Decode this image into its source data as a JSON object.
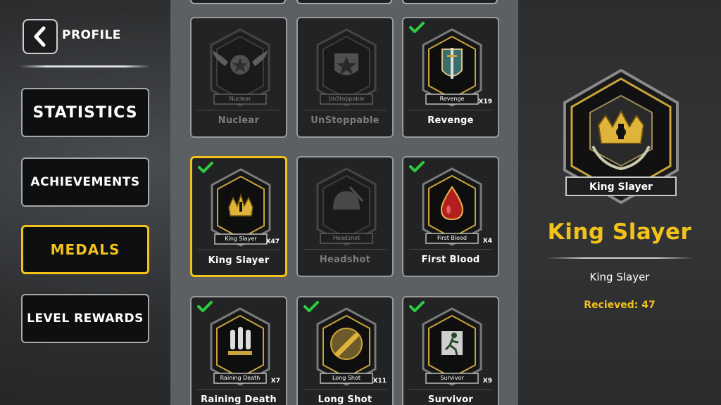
{
  "header": {
    "back_icon": "chevron-left-icon",
    "title": "PROFILE"
  },
  "nav": [
    {
      "label": "STATISTICS",
      "active": false
    },
    {
      "label": "ACHIEVEMENTS",
      "active": false
    },
    {
      "label": "MEDALS",
      "active": true
    },
    {
      "label": "LEVEL REWARDS",
      "active": false
    }
  ],
  "medals": [
    {
      "name": "Nuclear",
      "ribbon": "Nuclear",
      "count": "",
      "unlocked": false,
      "icon": "wings-star-icon"
    },
    {
      "name": "UnStoppable",
      "ribbon": "UnStoppable",
      "count": "",
      "unlocked": false,
      "icon": "shield-star-icon"
    },
    {
      "name": "Revenge",
      "ribbon": "Revenge",
      "count": "X19",
      "unlocked": true,
      "icon": "shield-dagger-icon"
    },
    {
      "name": "King Slayer",
      "ribbon": "King Slayer",
      "count": "X47",
      "unlocked": true,
      "selected": true,
      "icon": "crown-icon"
    },
    {
      "name": "Headshot",
      "ribbon": "Headshot",
      "count": "",
      "unlocked": false,
      "icon": "helmet-icon"
    },
    {
      "name": "First Blood",
      "ribbon": "First Blood",
      "count": "X4",
      "unlocked": true,
      "icon": "blood-drop-icon"
    },
    {
      "name": "Raining Death",
      "ribbon": "Raining Death",
      "count": "X7",
      "unlocked": true,
      "icon": "bombs-icon"
    },
    {
      "name": "Long Shot",
      "ribbon": "Long Shot",
      "count": "X11",
      "unlocked": true,
      "icon": "bullet-icon"
    },
    {
      "name": "Survivor",
      "ribbon": "Survivor",
      "count": "X9",
      "unlocked": true,
      "icon": "runner-icon"
    }
  ],
  "detail": {
    "ribbon": "King Slayer",
    "title": "King Slayer",
    "description": "King Slayer",
    "received": "Recieved: 47"
  },
  "colors": {
    "accent": "#f2c21b",
    "check": "#2ecc40",
    "card_bg": "#222325",
    "panel_mid": "#5d6063"
  }
}
